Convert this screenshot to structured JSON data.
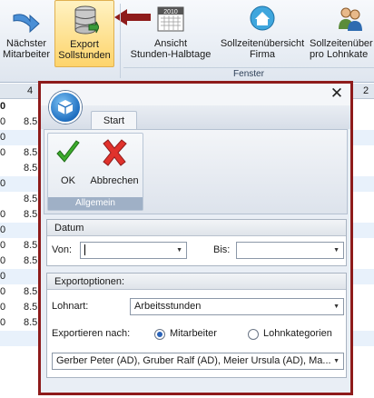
{
  "background_ribbon": {
    "buttons": [
      {
        "name": "naechster-mitarbeiter",
        "label": "Nächster\nMitarbeiter"
      },
      {
        "name": "export-sollstunden",
        "label": "Export\nSollstunden"
      },
      {
        "name": "ansicht-stunden-halbtage",
        "label": "Ansicht\nStunden-Halbtage"
      },
      {
        "name": "sollzeitenuebersicht-firma",
        "label": "Sollzeitenübersicht\nFirma"
      },
      {
        "name": "sollzeitenuebersicht-lohnkategorien",
        "label": "Sollzeitenüber\npro Lohnkate"
      }
    ],
    "group_label": "Fenster",
    "calendar_year": "2010"
  },
  "background_grid": {
    "header_cells": [
      "4",
      "2"
    ],
    "rows": [
      "0",
      "0",
      "0",
      "0",
      "0",
      "0",
      "0",
      "0",
      "0",
      "0",
      "0",
      "0"
    ],
    "values": [
      "8.5",
      "8.5",
      "8.5",
      "8.5",
      "8.5",
      "8.5",
      "8.5",
      "8.5",
      "8.5",
      "8.5"
    ],
    "bold_row_label": "0"
  },
  "dialog": {
    "close_symbol": "✕",
    "tab": "Start",
    "ok_label": "OK",
    "cancel_label": "Abbrechen",
    "group_label": "Allgemein",
    "datum": {
      "header": "Datum",
      "von_label": "Von:",
      "von_value": "",
      "bis_label": "Bis:",
      "bis_value": ""
    },
    "export": {
      "header": "Exportoptionen:",
      "lohnart_label": "Lohnart:",
      "lohnart_value": "Arbeitsstunden",
      "exportieren_label": "Exportieren nach:",
      "radio_mitarbeiter": "Mitarbeiter",
      "radio_lohnkategorien": "Lohnkategorien",
      "selected": "Mitarbeiter",
      "mitarbeiter_value": "Gerber Peter (AD), Gruber Ralf (AD), Meier Ursula (AD), Ma..."
    }
  },
  "colors": {
    "highlight_border": "#8e1b1b",
    "export_button_bg": "#fde08a",
    "arrow": "#8e1b1b"
  }
}
